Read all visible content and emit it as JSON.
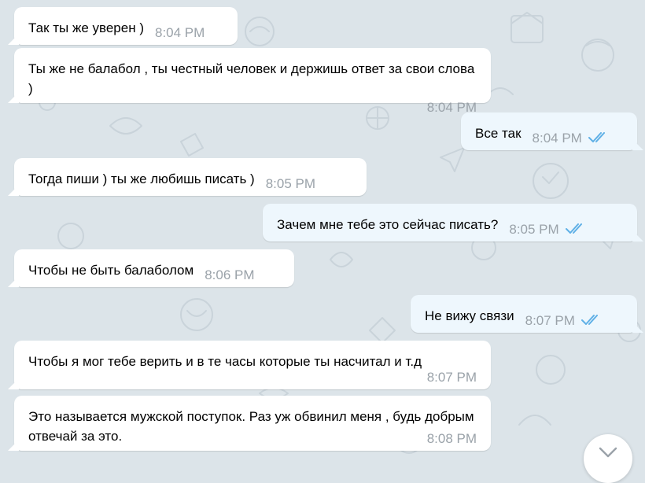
{
  "messages": [
    {
      "direction": "in",
      "text": "Так ты же уверен )",
      "time": "8:04 PM"
    },
    {
      "direction": "in",
      "text": "Ты же не балабол , ты честный человек и держишь ответ за свои слова )",
      "time": "8:04 PM"
    },
    {
      "direction": "out",
      "text": "Все так",
      "time": "8:04 PM",
      "status": "read"
    },
    {
      "direction": "in",
      "text": "Тогда пиши ) ты же любишь писать )",
      "time": "8:05 PM"
    },
    {
      "direction": "out",
      "text": "Зачем мне тебе это сейчас писать?",
      "time": "8:05 PM",
      "status": "read"
    },
    {
      "direction": "in",
      "text": "Чтобы не быть балаболом",
      "time": "8:06 PM"
    },
    {
      "direction": "out",
      "text": "Не вижу связи",
      "time": "8:07 PM",
      "status": "read"
    },
    {
      "direction": "in",
      "text": "Чтобы я мог тебе верить и в те часы которые ты насчитал и т.д",
      "time": "8:07 PM"
    },
    {
      "direction": "in",
      "text": "Это называется мужской поступок. Раз уж обвинил меня , будь добрым отвечай за это.",
      "time": "8:08 PM"
    }
  ],
  "icons": {
    "read_status": "double-check-icon",
    "scroll_down": "chevron-down-icon"
  },
  "colors": {
    "background": "#dce4e9",
    "incoming_bubble": "#ffffff",
    "outgoing_bubble": "#eef7fd",
    "timestamp": "#9aa2a9",
    "check_marks": "#5fb0e6"
  }
}
